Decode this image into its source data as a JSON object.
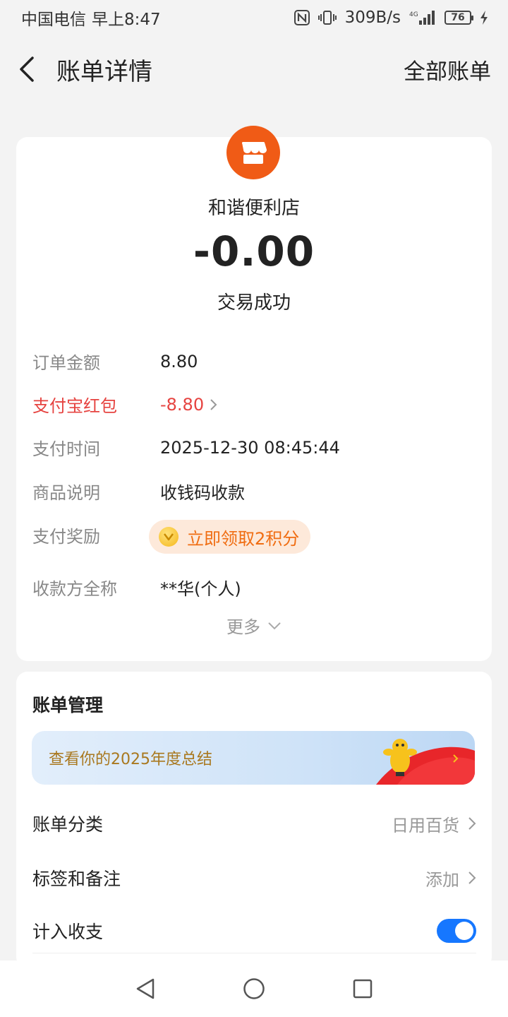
{
  "status_bar": {
    "carrier": "中国电信",
    "time": "早上8:47",
    "speed": "309B/s",
    "battery": "76",
    "icons": [
      "nfc-icon",
      "vibrate-icon",
      "4g-signal-icon",
      "battery-icon",
      "charging-icon"
    ]
  },
  "header": {
    "title": "账单详情",
    "right_link": "全部账单"
  },
  "transaction": {
    "merchant": "和谐便利店",
    "amount": "-0.00",
    "status": "交易成功",
    "logo_color": "#f05b16",
    "details": [
      {
        "label": "订单金额",
        "value": "8.80"
      },
      {
        "label": "支付宝红包",
        "value": "-8.80"
      },
      {
        "label": "支付时间",
        "value": "2025-12-30 08:45:44"
      },
      {
        "label": "商品说明",
        "value": "收钱码收款"
      },
      {
        "label": "支付奖励",
        "value": "立即领取2积分"
      },
      {
        "label": "收款方全称",
        "value": "**华(个人)"
      }
    ],
    "more": "更多"
  },
  "management": {
    "title": "账单管理",
    "banner": "查看你的2025年度总结",
    "rows": [
      {
        "label": "账单分类",
        "value": "日用百货"
      },
      {
        "label": "标签和备注",
        "value": "添加"
      },
      {
        "label": "计入收支",
        "toggle_on": true
      }
    ]
  },
  "colors": {
    "accent_red": "#e64340",
    "toggle_blue": "#1677ff",
    "reward_orange": "#f06d12"
  }
}
